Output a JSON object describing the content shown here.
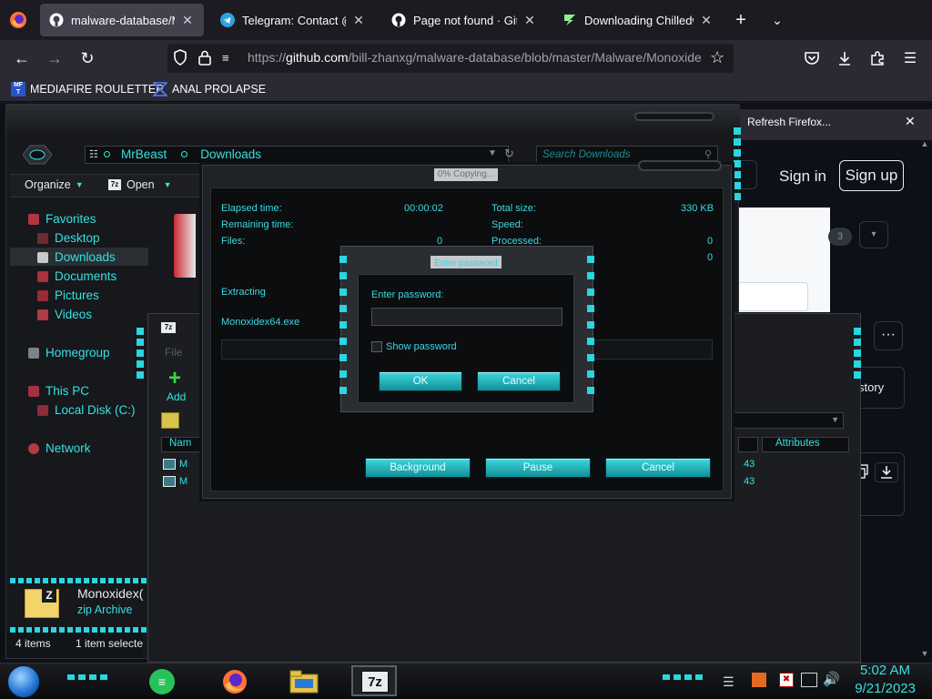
{
  "browser": {
    "tabs": [
      {
        "title": "malware-database/Malw",
        "icon": "github-icon",
        "active": true
      },
      {
        "title": "Telegram: Contact @ma",
        "icon": "telegram-icon",
        "active": false
      },
      {
        "title": "Page not found · GitHub",
        "icon": "github-icon",
        "active": false
      },
      {
        "title": "Downloading Chilledwin",
        "icon": "download-site-icon",
        "active": false
      }
    ],
    "new_tab_label": "+",
    "url_scheme": "https://",
    "url_host": "github.com",
    "url_path": "/bill-zhanxg/malware-database/blob/master/Malware/Monoxide",
    "bookmarks": [
      {
        "label": "MEDIAFIRE ROULETTER",
        "icon": "mediafire-icon"
      },
      {
        "label": "ANAL PROLAPSE",
        "icon": "bookmark-icon"
      }
    ],
    "notification": "Refresh Firefox...",
    "github": {
      "sign_in": "Sign in",
      "sign_up": "Sign up",
      "counter": "3",
      "history_fragment": "story"
    }
  },
  "explorer": {
    "breadcrumb": [
      "MrBeast",
      "Downloads"
    ],
    "search_placeholder": "Search Downloads",
    "toolbar": {
      "organize": "Organize",
      "open": "Open"
    },
    "nav": {
      "favorites": "Favorites",
      "desktop": "Desktop",
      "downloads": "Downloads",
      "documents": "Documents",
      "pictures": "Pictures",
      "videos": "Videos",
      "homegroup": "Homegroup",
      "this_pc": "This PC",
      "local_disk": "Local Disk (C:)",
      "network": "Network"
    },
    "details": {
      "name": "Monoxidex(",
      "type": "zip Archive"
    },
    "status": {
      "items": "4 items",
      "selected": "1 item selecte"
    }
  },
  "sevenzip_window": {
    "add_label": "Add",
    "file_menu": "File",
    "col_name": "Nam",
    "col_attributes": "Attributes",
    "row_frag_1": "43",
    "row_frag_2": "43"
  },
  "copy_dialog": {
    "title": "0% Copying...",
    "elapsed_label": "Elapsed time:",
    "elapsed_value": "00:00:02",
    "remaining_label": "Remaining time:",
    "files_label": "Files:",
    "files_value": "0",
    "total_size_label": "Total size:",
    "total_size_value": "330 KB",
    "speed_label": "Speed:",
    "processed_label": "Processed:",
    "processed_value": "0",
    "extra_value": "0",
    "extracting_label": "Extracting",
    "file_name": "Monoxidex64.exe",
    "buttons": {
      "background": "Background",
      "pause": "Pause",
      "cancel": "Cancel"
    }
  },
  "password_dialog": {
    "title": "Enter password",
    "prompt": "Enter password:",
    "password_value": "",
    "show_password": "Show password",
    "ok": "OK",
    "cancel": "Cancel"
  },
  "taskbar": {
    "time": "5:02 AM",
    "date": "9/21/2023",
    "apps": [
      "start-orb-icon",
      "notes-app-icon",
      "firefox-icon",
      "file-explorer-icon",
      "7zip-icon"
    ]
  },
  "colors": {
    "accent": "#34e1e1",
    "button": "#20b8c2",
    "bg": "#0c0d0f"
  }
}
